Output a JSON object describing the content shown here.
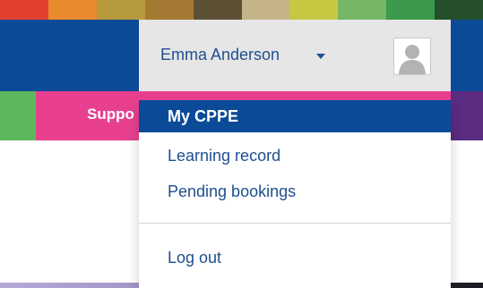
{
  "stripe_colors": [
    "#e2412f",
    "#ea8a2f",
    "#b79a3e",
    "#a57a32",
    "#5c5034",
    "#c4b488",
    "#c7c842",
    "#76b766",
    "#3b9a4c",
    "#244f2a"
  ],
  "header": {
    "background": "#0b4a97"
  },
  "navbar": {
    "colors": [
      "#5cb85c",
      "#e8408f",
      "#e8408f",
      "#5b2c82"
    ],
    "partial_label": "Suppo"
  },
  "user_menu": {
    "name": "Emma Anderson",
    "avatar_icon": "person-placeholder-icon",
    "caret_icon": "caret-down-icon"
  },
  "dropdown": {
    "items": [
      {
        "label": "My CPPE",
        "active": true
      },
      {
        "label": "Learning record",
        "active": false
      },
      {
        "label": "Pending bookings",
        "active": false
      }
    ],
    "logout_label": "Log out",
    "active_color": "#0b4a97",
    "link_color": "#1f4f8f"
  }
}
